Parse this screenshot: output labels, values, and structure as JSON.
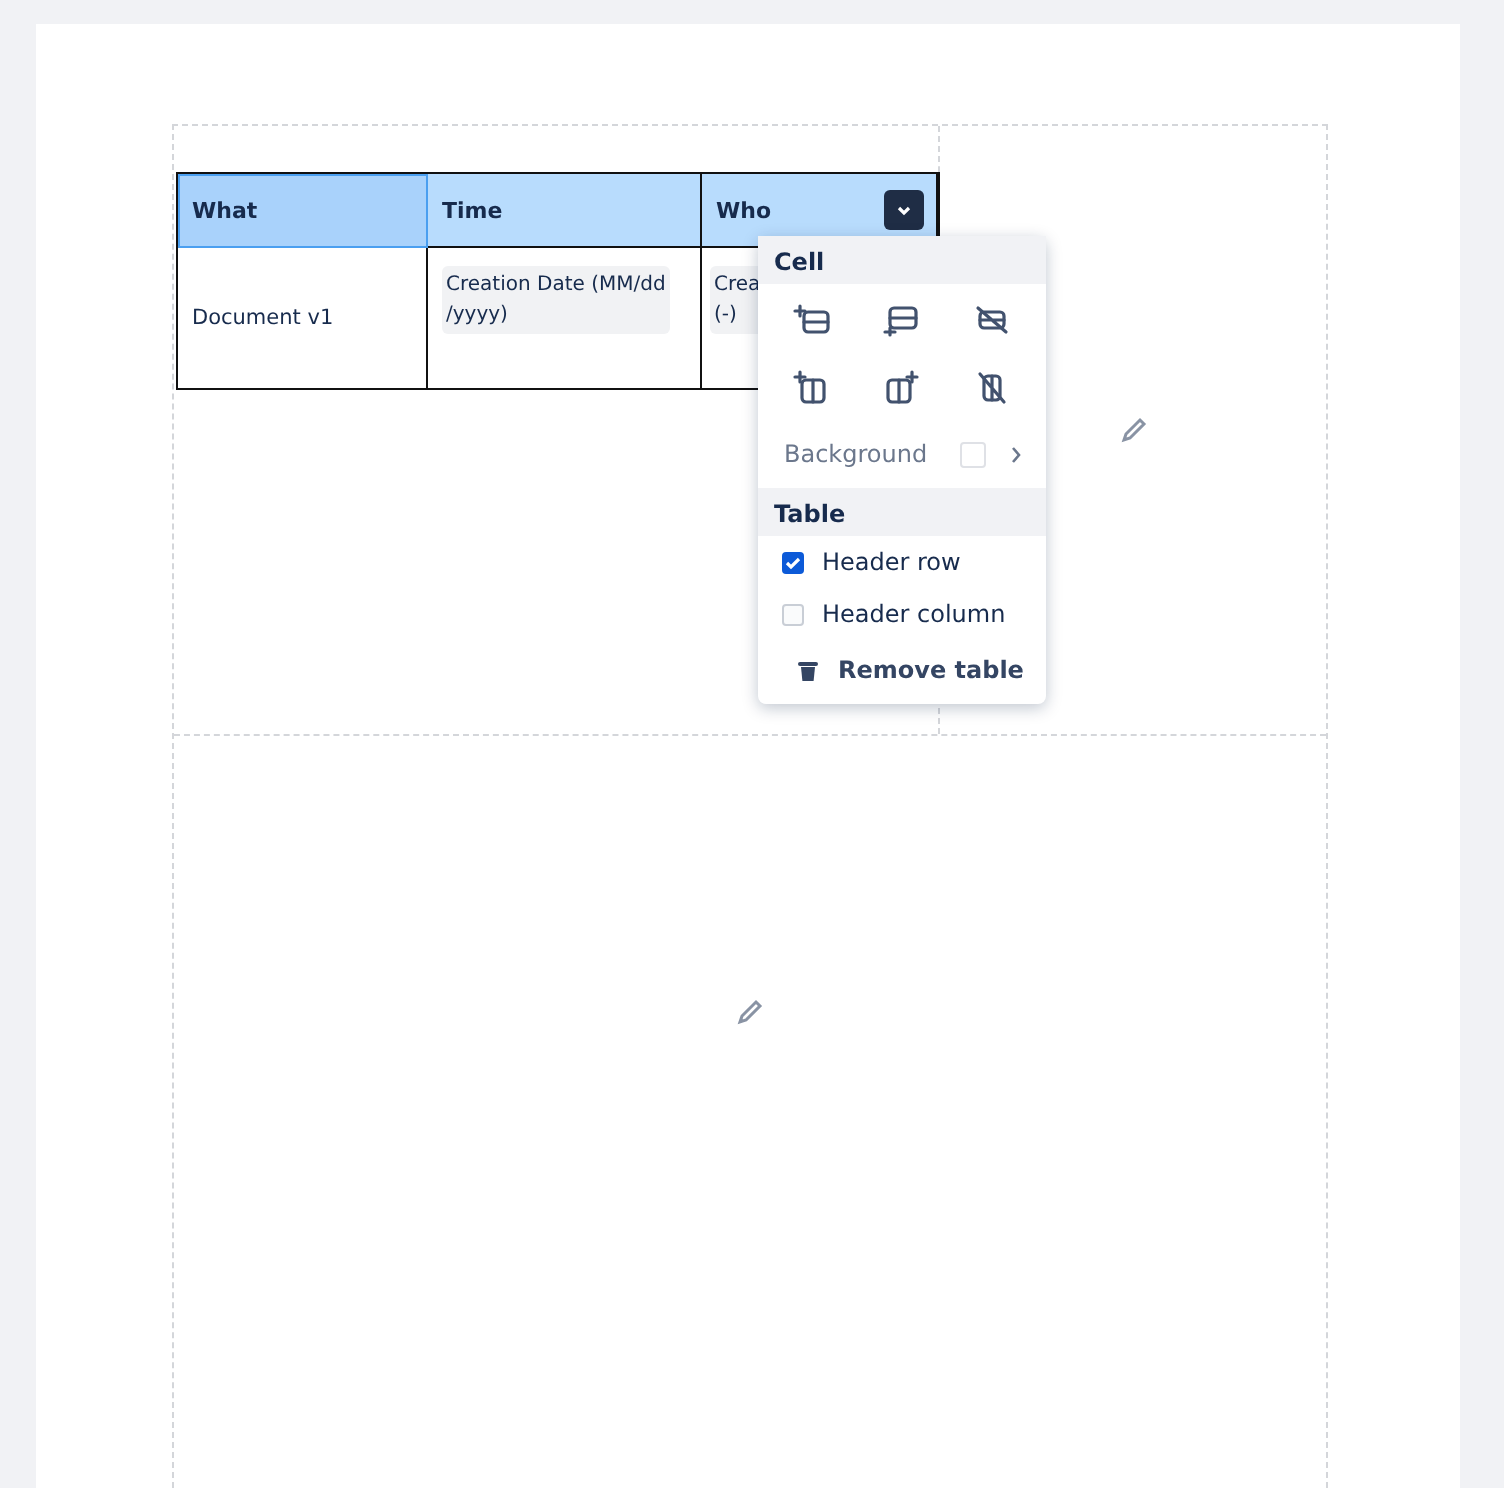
{
  "table": {
    "columns": [
      {
        "label": "What",
        "selected": true
      },
      {
        "label": "Time",
        "selected": false
      },
      {
        "label": "Who",
        "selected": false,
        "menu_button": true
      }
    ],
    "rows": [
      [
        {
          "kind": "text",
          "lines": [
            "Document v1"
          ]
        },
        {
          "kind": "chip",
          "lines": [
            "Creation Date (MM/dd",
            "/yyyy)"
          ]
        },
        {
          "kind": "chip",
          "lines": [
            "Crea",
            "(-)"
          ]
        }
      ]
    ]
  },
  "menu": {
    "sections": [
      {
        "title": "Cell",
        "items": [
          {
            "kind": "icons",
            "actions": [
              {
                "kind": "row-above"
              },
              {
                "kind": "row-below"
              },
              {
                "kind": "row-delete"
              },
              {
                "kind": "col-left"
              },
              {
                "kind": "col-right"
              },
              {
                "kind": "col-delete"
              }
            ]
          },
          {
            "kind": "background",
            "label": "Background"
          }
        ]
      },
      {
        "title": "Table",
        "items": [
          {
            "kind": "checkbox",
            "label": "Header row",
            "checked": true
          },
          {
            "kind": "checkbox",
            "label": "Header column",
            "checked": false
          },
          {
            "kind": "action",
            "label": "Remove table"
          }
        ]
      }
    ]
  }
}
